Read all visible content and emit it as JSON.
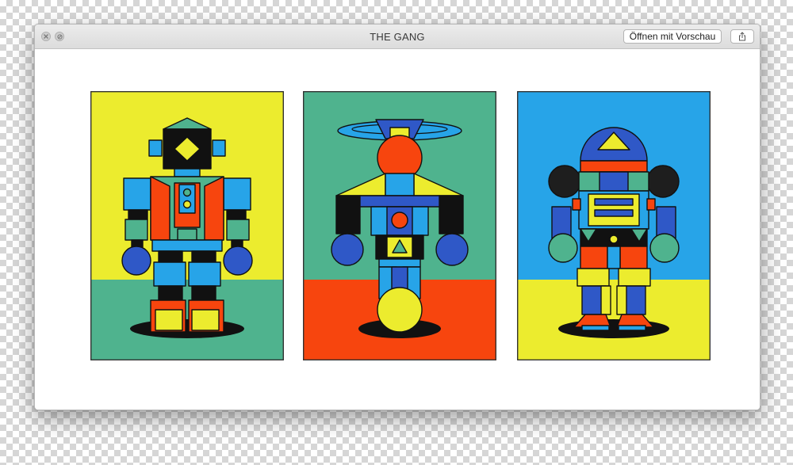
{
  "window": {
    "title": "THE GANG",
    "open_button_label": "Öffnen mit Vorschau",
    "close_icon": "close-icon",
    "fullscreen_icon": "fullscreen-icon",
    "share_icon": "share-icon"
  },
  "artwork": {
    "panels": [
      {
        "name": "robot-1",
        "top_color": "#ECEC2E",
        "bottom_color": "#4FB38E"
      },
      {
        "name": "robot-2",
        "top_color": "#4FB38E",
        "bottom_color": "#F7450E"
      },
      {
        "name": "robot-3",
        "top_color": "#27A4E8",
        "bottom_color": "#ECEC2E"
      }
    ],
    "palette": {
      "yellow": "#ECEC2E",
      "green": "#4FB38E",
      "blue": "#27A4E8",
      "dark_blue": "#2F58C7",
      "red": "#F7450E",
      "black": "#111111"
    }
  }
}
